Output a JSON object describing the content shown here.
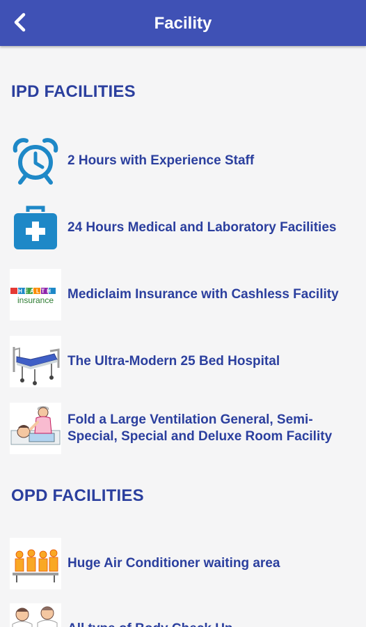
{
  "appbar": {
    "title": "Facility",
    "back_icon": "chevron-left-icon",
    "color": "#3f51b5"
  },
  "sections": {
    "ipd": {
      "title": "IPD FACILITIES",
      "items": [
        {
          "label": "2 Hours with Experience Staff",
          "icon": "alarm-clock-icon"
        },
        {
          "label": "24 Hours Medical and Laboratory Facilities",
          "icon": "medical-kit-icon"
        },
        {
          "label": "Mediclaim Insurance with Cashless Facility",
          "icon": "health-insurance-icon",
          "icon_text_top": "HEALTH",
          "icon_text_bottom": "insurance"
        },
        {
          "label": "The Ultra-Modern 25 Bed Hospital",
          "icon": "hospital-bed-icon"
        },
        {
          "label": "Fold a Large Ventilation General, Semi-Special, Special and Deluxe Room Facility",
          "icon": "nurse-patient-icon"
        }
      ]
    },
    "opd": {
      "title": "OPD FACILITIES",
      "items": [
        {
          "label": "Huge Air Conditioner waiting area",
          "icon": "waiting-area-icon"
        },
        {
          "label": "All type of Body Check Up",
          "icon": "doctors-icon"
        }
      ]
    }
  },
  "colors": {
    "text": "#2b3f9e",
    "icon_blue": "#1e88c7",
    "background": "#f5f5f6"
  }
}
